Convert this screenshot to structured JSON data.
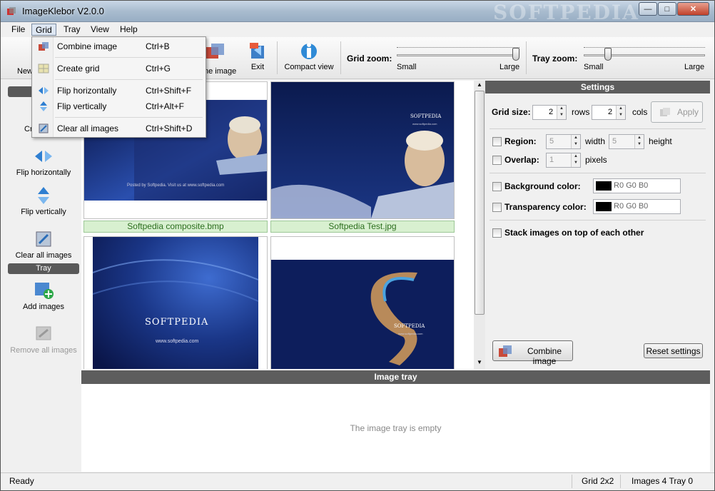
{
  "window": {
    "title": "ImageKlebor V2.0.0",
    "watermark": "SOFTPEDIA",
    "minimize_glyph": "—",
    "maximize_glyph": "□",
    "close_glyph": "✕"
  },
  "menu": {
    "items": [
      {
        "label": "File"
      },
      {
        "label": "Grid"
      },
      {
        "label": "Tray"
      },
      {
        "label": "View"
      },
      {
        "label": "Help"
      }
    ]
  },
  "grid_menu": {
    "items": [
      {
        "label": "Combine image",
        "shortcut": "Ctrl+B",
        "icon": "combine-icon"
      },
      {
        "label": "Create grid",
        "shortcut": "Ctrl+G",
        "icon": "grid-icon"
      },
      {
        "label": "Flip horizontally",
        "shortcut": "Ctrl+Shift+F",
        "icon": "flip-horizontal-icon"
      },
      {
        "label": "Flip vertically",
        "shortcut": "Ctrl+Alt+F",
        "icon": "flip-vertical-icon"
      },
      {
        "label": "Clear all images",
        "shortcut": "Ctrl+Shift+D",
        "icon": "clear-icon"
      }
    ]
  },
  "toolbar": {
    "new_partial": "New",
    "combine_partial": "ne image",
    "exit": "Exit",
    "compact_view": "Compact view",
    "grid_zoom_label": "Grid zoom:",
    "tray_zoom_label": "Tray zoom:",
    "small": "Small",
    "large": "Large",
    "grid_zoom_level": 1.0,
    "tray_zoom_level": 0.18
  },
  "sidebar": {
    "create_partial": "Cr",
    "flip_horizontally": "Flip horizontally",
    "flip_vertically": "Flip vertically",
    "clear_all_images": "Clear all images",
    "tray_header": "Tray",
    "add_images": "Add images",
    "remove_all_images": "Remove all images"
  },
  "grid_images": [
    {
      "caption": "Softpedia composite.bmp",
      "footer": "Posted by Softpedia. Visit us at www.softpedia.com"
    },
    {
      "caption": "Softpedia Test.jpg",
      "brand": "SOFTPEDIA",
      "url": "www.softpedia.com"
    },
    {
      "brand": "SOFTPEDIA",
      "url": "www.softpedia.com"
    },
    {
      "brand": "SOFTPEDIA",
      "url": "www.softpedia.com"
    }
  ],
  "settings": {
    "header": "Settings",
    "grid_size_label": "Grid size:",
    "rows_value": "2",
    "rows_label": "rows",
    "cols_value": "2",
    "cols_label": "cols",
    "apply": "Apply",
    "region_label": "Region:",
    "region_width": "5",
    "width_label": "width",
    "region_height": "5",
    "height_label": "height",
    "overlap_label": "Overlap:",
    "overlap_value": "1",
    "pixels_label": "pixels",
    "bg_color_label": "Background color:",
    "bg_color_value": "R0 G0 B0",
    "transparency_label": "Transparency color:",
    "transparency_value": "R0 G0 B0",
    "stack_label": "Stack images on top of each other",
    "combine_button": "Combine image",
    "reset_button": "Reset settings"
  },
  "tray": {
    "header": "Image tray",
    "empty_text": "The image tray is empty"
  },
  "status": {
    "ready": "Ready",
    "grid": "Grid 2x2",
    "counts": "Images 4 Tray 0"
  },
  "colors": {
    "header_bg": "#5d5d5d",
    "caption_bg": "#d8f0d0",
    "caption_text": "#2c6e1e",
    "image_blue": "#0d1e5c"
  }
}
